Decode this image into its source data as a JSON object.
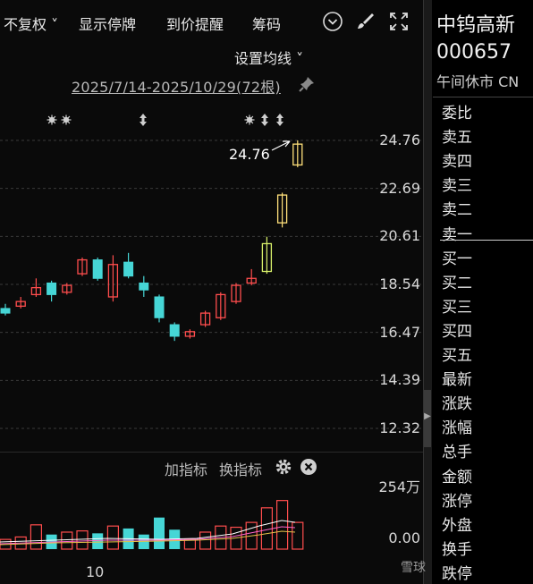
{
  "toolbar": {
    "fuquan": "不复权 ˅",
    "show_suspend": "显示停牌",
    "price_alert": "到价提醒",
    "chips": "筹码"
  },
  "chart": {
    "ma_setting": "设置均线 ˅",
    "range": "2025/7/14-2025/10/29(72根)",
    "price_ticks": [
      "24.76",
      "22.69",
      "20.61",
      "18.54",
      "16.47",
      "14.39",
      "12.32"
    ],
    "high_label": "24.76",
    "volume_ticks": [
      "254万",
      "0.00"
    ],
    "x_tick": "10"
  },
  "subpanel": {
    "add_indicator": "加指标",
    "switch_indicator": "换指标"
  },
  "quote": {
    "name": "中钨高新",
    "code": "000657",
    "status": "午间休市 CN",
    "rows": [
      "委比",
      "卖五",
      "卖四",
      "卖三",
      "卖二",
      "卖一",
      "买一",
      "买二",
      "买三",
      "买四",
      "买五",
      "最新",
      "涨跌",
      "涨幅",
      "总手",
      "金额",
      "涨停",
      "外盘",
      "换手",
      "跌停"
    ]
  },
  "watermark": "雪球",
  "chart_data": {
    "type": "candlestick",
    "ylim": [
      12.32,
      24.76
    ],
    "candles": [
      {
        "o": 17.5,
        "c": 17.3,
        "h": 17.7,
        "l": 17.2
      },
      {
        "o": 17.6,
        "c": 17.8,
        "h": 18.0,
        "l": 17.5
      },
      {
        "o": 18.1,
        "c": 18.4,
        "h": 18.8,
        "l": 18.0
      },
      {
        "o": 18.6,
        "c": 18.1,
        "h": 18.7,
        "l": 17.8
      },
      {
        "o": 18.2,
        "c": 18.5,
        "h": 18.6,
        "l": 18.1
      },
      {
        "o": 19.0,
        "c": 19.6,
        "h": 19.7,
        "l": 18.9
      },
      {
        "o": 19.6,
        "c": 18.8,
        "h": 19.7,
        "l": 18.7
      },
      {
        "o": 18.0,
        "c": 19.4,
        "h": 19.8,
        "l": 17.8
      },
      {
        "o": 19.5,
        "c": 18.9,
        "h": 19.9,
        "l": 18.8
      },
      {
        "o": 18.6,
        "c": 18.3,
        "h": 18.9,
        "l": 18.0
      },
      {
        "o": 18.0,
        "c": 17.1,
        "h": 18.1,
        "l": 16.9
      },
      {
        "o": 16.8,
        "c": 16.3,
        "h": 16.9,
        "l": 16.1
      },
      {
        "o": 16.3,
        "c": 16.5,
        "h": 16.6,
        "l": 16.2
      },
      {
        "o": 16.8,
        "c": 17.3,
        "h": 17.4,
        "l": 16.7
      },
      {
        "o": 17.1,
        "c": 18.1,
        "h": 18.2,
        "l": 17.0
      },
      {
        "o": 17.8,
        "c": 18.5,
        "h": 18.6,
        "l": 17.7
      },
      {
        "o": 18.6,
        "c": 18.8,
        "h": 19.2,
        "l": 18.5
      },
      {
        "o": 19.1,
        "c": 20.3,
        "h": 20.6,
        "l": 19.0
      },
      {
        "o": 21.2,
        "c": 22.4,
        "h": 22.5,
        "l": 21.0
      },
      {
        "o": 23.7,
        "c": 24.6,
        "h": 24.76,
        "l": 23.6
      }
    ],
    "volume": [
      {
        "v": 40,
        "up": true
      },
      {
        "v": 50,
        "up": true
      },
      {
        "v": 100,
        "up": true
      },
      {
        "v": 60,
        "up": false
      },
      {
        "v": 70,
        "up": true
      },
      {
        "v": 75,
        "up": true
      },
      {
        "v": 65,
        "up": false
      },
      {
        "v": 95,
        "up": true
      },
      {
        "v": 85,
        "up": false
      },
      {
        "v": 60,
        "up": false
      },
      {
        "v": 130,
        "up": false
      },
      {
        "v": 80,
        "up": false
      },
      {
        "v": 40,
        "up": true
      },
      {
        "v": 70,
        "up": true
      },
      {
        "v": 95,
        "up": true
      },
      {
        "v": 90,
        "up": true
      },
      {
        "v": 110,
        "up": true
      },
      {
        "v": 170,
        "up": true
      },
      {
        "v": 200,
        "up": true
      },
      {
        "v": 110,
        "up": true
      }
    ]
  }
}
